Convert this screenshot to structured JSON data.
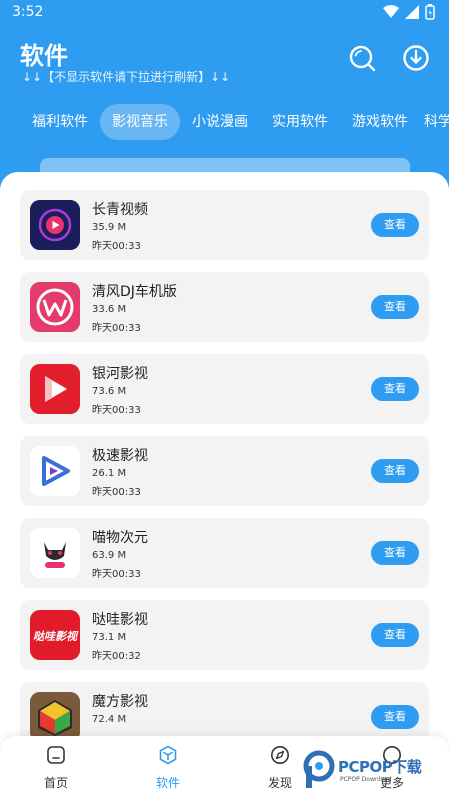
{
  "status_bar": {
    "time": "3:52"
  },
  "header": {
    "title": "软件",
    "subtitle": "↓↓【不显示软件请下拉进行刷新】↓↓",
    "search_icon": "search-icon",
    "download_icon": "download-icon"
  },
  "tabs": [
    {
      "label": "福利软件",
      "active": false
    },
    {
      "label": "影视音乐",
      "active": true
    },
    {
      "label": "小说漫画",
      "active": false
    },
    {
      "label": "实用软件",
      "active": false
    },
    {
      "label": "游戏软件",
      "active": false
    },
    {
      "label": "科学",
      "active": false
    }
  ],
  "apps": [
    {
      "name": "长青视频",
      "size": "35.9 M",
      "time": "昨天00:33",
      "button": "查看",
      "icon": "play-icon",
      "color": "#1a1f5c"
    },
    {
      "name": "清风DJ车机版",
      "size": "33.6 M",
      "time": "昨天00:33",
      "button": "查看",
      "icon": "w-logo-icon",
      "color": "#e43b6c"
    },
    {
      "name": "银河影视",
      "size": "73.6 M",
      "time": "昨天00:33",
      "button": "查看",
      "icon": "play-icon",
      "color": "#e41f2d"
    },
    {
      "name": "极速影视",
      "size": "26.1 M",
      "time": "昨天00:33",
      "button": "查看",
      "icon": "play-icon",
      "color": "#ffffff"
    },
    {
      "name": "喵物次元",
      "size": "63.9 M",
      "time": "昨天00:33",
      "button": "查看",
      "icon": "cat-icon",
      "color": "#ffffff"
    },
    {
      "name": "哒哇影视",
      "size": "73.1 M",
      "time": "昨天00:32",
      "button": "查看",
      "icon": "text-logo-icon",
      "color": "#e21b2a",
      "logo_text": "哒哇影视"
    },
    {
      "name": "魔方影视",
      "size": "72.4 M",
      "time": "",
      "button": "查看",
      "icon": "cube-icon",
      "color": "#7a5a3a"
    }
  ],
  "bottom_nav": [
    {
      "label": "首页",
      "icon": "home-icon",
      "active": false
    },
    {
      "label": "软件",
      "icon": "cube-icon",
      "active": true
    },
    {
      "label": "发现",
      "icon": "compass-icon",
      "active": false
    },
    {
      "label": "更多",
      "icon": "more-icon",
      "active": false
    }
  ],
  "watermark": {
    "text": "PCPOP下载",
    "sub": "PCPOP Download"
  },
  "colors": {
    "accent": "#2e9cf0",
    "card_bg": "#f3f3f3"
  }
}
